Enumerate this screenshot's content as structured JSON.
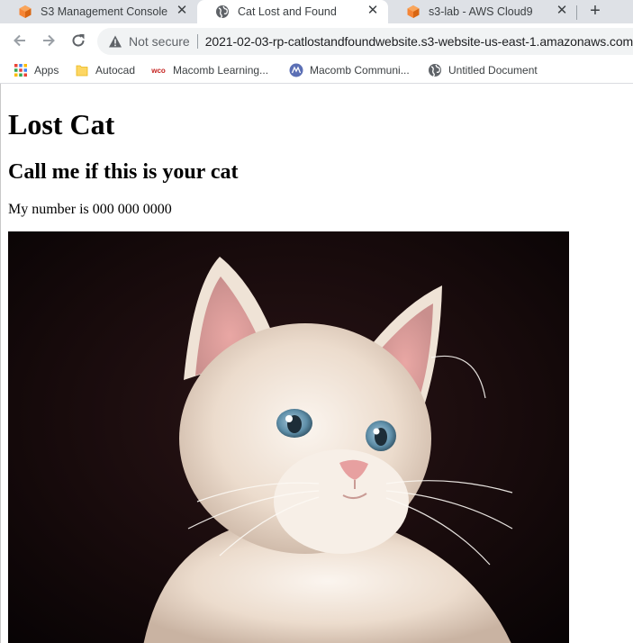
{
  "browser": {
    "tabs": [
      {
        "title": "S3 Management Console",
        "icon": "aws-cube-icon",
        "active": false
      },
      {
        "title": "Cat Lost and Found",
        "icon": "globe-icon",
        "active": true
      },
      {
        "title": "s3-lab - AWS Cloud9",
        "icon": "aws-cube-icon",
        "active": false
      }
    ],
    "new_tab": "+",
    "close_glyph": "✕",
    "address": {
      "security_label": "Not secure",
      "url": "2021-02-03-rp-catlostandfoundwebsite.s3-website-us-east-1.amazonaws.com"
    },
    "bookmarks": [
      {
        "label": "Apps",
        "icon": "apps-grid-icon"
      },
      {
        "label": "Autocad",
        "icon": "folder-icon"
      },
      {
        "label": "Macomb Learning...",
        "icon": "wco-logo-icon"
      },
      {
        "label": "Macomb Communi...",
        "icon": "macomb-logo-icon"
      },
      {
        "label": "Untitled Document",
        "icon": "globe-icon"
      }
    ],
    "wco_text": "wco"
  },
  "page": {
    "heading": "Lost Cat",
    "subheading": "Call me if this is your cat",
    "contact": "My number is 000 000 0000",
    "image_subject": "kitten-photo"
  },
  "colors": {
    "tabstrip_bg": "#dee1e6",
    "aws_orange": "#f58536",
    "photo_bg": "#120809"
  }
}
